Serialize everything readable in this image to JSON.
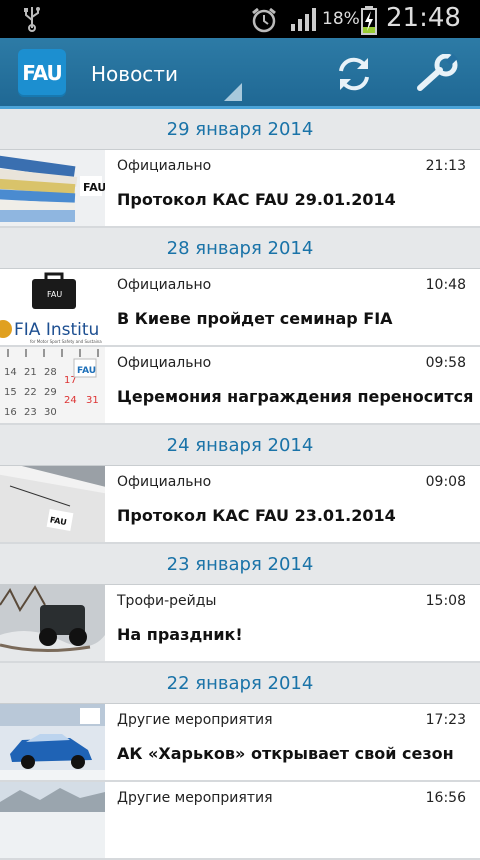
{
  "status_bar": {
    "battery": "18%",
    "time": "21:48"
  },
  "app_bar": {
    "logo": "FAU",
    "title": "Новости"
  },
  "news": [
    {
      "date": "29 января 2014",
      "items": [
        {
          "category": "Официально",
          "time": "21:13",
          "title": "Протокол КАС FAU 29.01.2014",
          "thumb": "folders"
        }
      ]
    },
    {
      "date": "28 января 2014",
      "items": [
        {
          "category": "Официально",
          "time": "10:48",
          "title": "В Киеве пройдет семинар FIA",
          "thumb": "fia-institute",
          "thumb_text": "FIA Institu",
          "thumb_subtext": "for Motor Sport Safety and Sustaina"
        },
        {
          "category": "Официально",
          "time": "09:58",
          "title": "Церемония награждения переносится",
          "thumb": "calendar",
          "thumb_numbers": [
            "14",
            "21",
            "28",
            "15",
            "22",
            "29",
            "16",
            "23",
            "30",
            "17",
            "24",
            "31"
          ]
        }
      ]
    },
    {
      "date": "24 января 2014",
      "items": [
        {
          "category": "Официально",
          "time": "09:08",
          "title": "Протокол КАС FAU 23.01.2014",
          "thumb": "papers"
        }
      ]
    },
    {
      "date": "23 января 2014",
      "items": [
        {
          "category": "Трофи-рейды",
          "time": "15:08",
          "title": "На праздник!",
          "thumb": "offroad"
        }
      ]
    },
    {
      "date": "22 января 2014",
      "items": [
        {
          "category": "Другие мероприятия",
          "time": "17:23",
          "title": "АК «Харьков» открывает свой сезон",
          "thumb": "rally-car"
        },
        {
          "category": "Другие мероприятия",
          "time": "16:56",
          "title": "",
          "thumb": "landscape"
        }
      ]
    }
  ]
}
